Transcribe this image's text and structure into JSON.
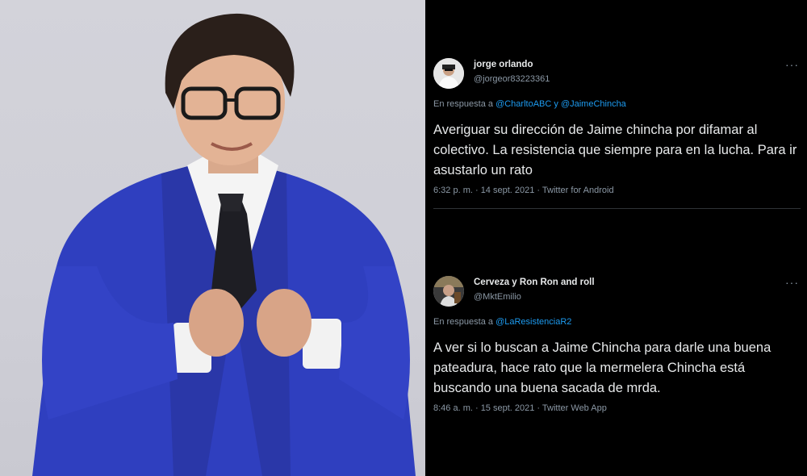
{
  "photo": {
    "alt_subject": "portrait"
  },
  "colors": {
    "background": "#000000",
    "text": "#e7e9ea",
    "muted": "#8b98a5",
    "link": "#1d9bf0",
    "suit": "#2f3fbf"
  },
  "tweets": [
    {
      "name": "jorge orlando",
      "handle": "@jorgeor83223361",
      "more": "···",
      "reply_prefix": "En respuesta a",
      "mentions": [
        "@CharltoABC",
        "@JaimeChincha"
      ],
      "reply_joiner": "y",
      "text": "Averiguar su dirección de Jaime chincha  por difamar al colectivo. La resistencia que siempre para en la lucha. Para ir  asustarlo un rato",
      "meta": "6:32 p. m. · 14 sept. 2021 · Twitter for Android"
    },
    {
      "name": "Cerveza y Ron Ron and roll",
      "handle": "@MktEmilio",
      "more": "···",
      "reply_prefix": "En respuesta a",
      "mentions": [
        "@LaResistenciaR2"
      ],
      "text": "A ver si lo buscan a Jaime Chincha para darle una buena pateadura, hace rato que la mermelera Chincha está buscando una buena sacada de mrda.",
      "meta": "8:46 a. m. · 15 sept. 2021 · Twitter Web App"
    }
  ]
}
